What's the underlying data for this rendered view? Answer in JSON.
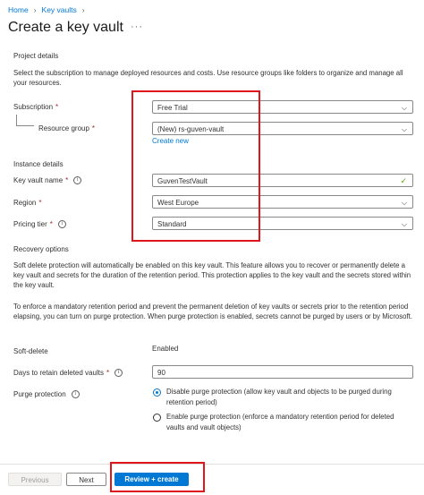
{
  "breadcrumb": {
    "items": [
      "Home",
      "Key vaults"
    ]
  },
  "page": {
    "title": "Create a key vault",
    "more": "···"
  },
  "project_details": {
    "heading": "Project details",
    "description": "Select the subscription to manage deployed resources and costs. Use resource groups like folders to organize and manage all your resources.",
    "subscription_label": "Subscription",
    "subscription_value": "Free Trial",
    "resource_group_label": "Resource group",
    "resource_group_value": "(New) rs-guven-vault",
    "create_new": "Create new"
  },
  "instance_details": {
    "heading": "Instance details",
    "name_label": "Key vault name",
    "name_value": "GuvenTestVault",
    "region_label": "Region",
    "region_value": "West Europe",
    "pricing_label": "Pricing tier",
    "pricing_value": "Standard"
  },
  "recovery": {
    "heading": "Recovery options",
    "para1": "Soft delete protection will automatically be enabled on this key vault. This feature allows you to recover or permanently delete a key vault and secrets for the duration of the retention period. This protection applies to the key vault and the secrets stored within the key vault.",
    "para2": "To enforce a mandatory retention period and prevent the permanent deletion of key vaults or secrets prior to the retention period elapsing, you can turn on purge protection. When purge protection is enabled, secrets cannot be purged by users or by Microsoft.",
    "soft_delete_label": "Soft-delete",
    "soft_delete_value": "Enabled",
    "retention_label": "Days to retain deleted vaults",
    "retention_value": "90",
    "purge_label": "Purge protection",
    "purge_options": [
      "Disable purge protection (allow key vault and objects to be purged during retention period)",
      "Enable purge protection (enforce a mandatory retention period for deleted vaults and vault objects)"
    ],
    "purge_selected_index": 0
  },
  "footer": {
    "previous": "Previous",
    "next": "Next",
    "review_create": "Review + create"
  },
  "icons": {
    "info": "info-icon",
    "dropdown": "chevron-down-icon",
    "valid": "checkmark-icon",
    "required": "*"
  },
  "colors": {
    "accent": "#0078d4",
    "highlight": "#e0161c",
    "valid": "#57a300",
    "required": "#a4262c"
  }
}
